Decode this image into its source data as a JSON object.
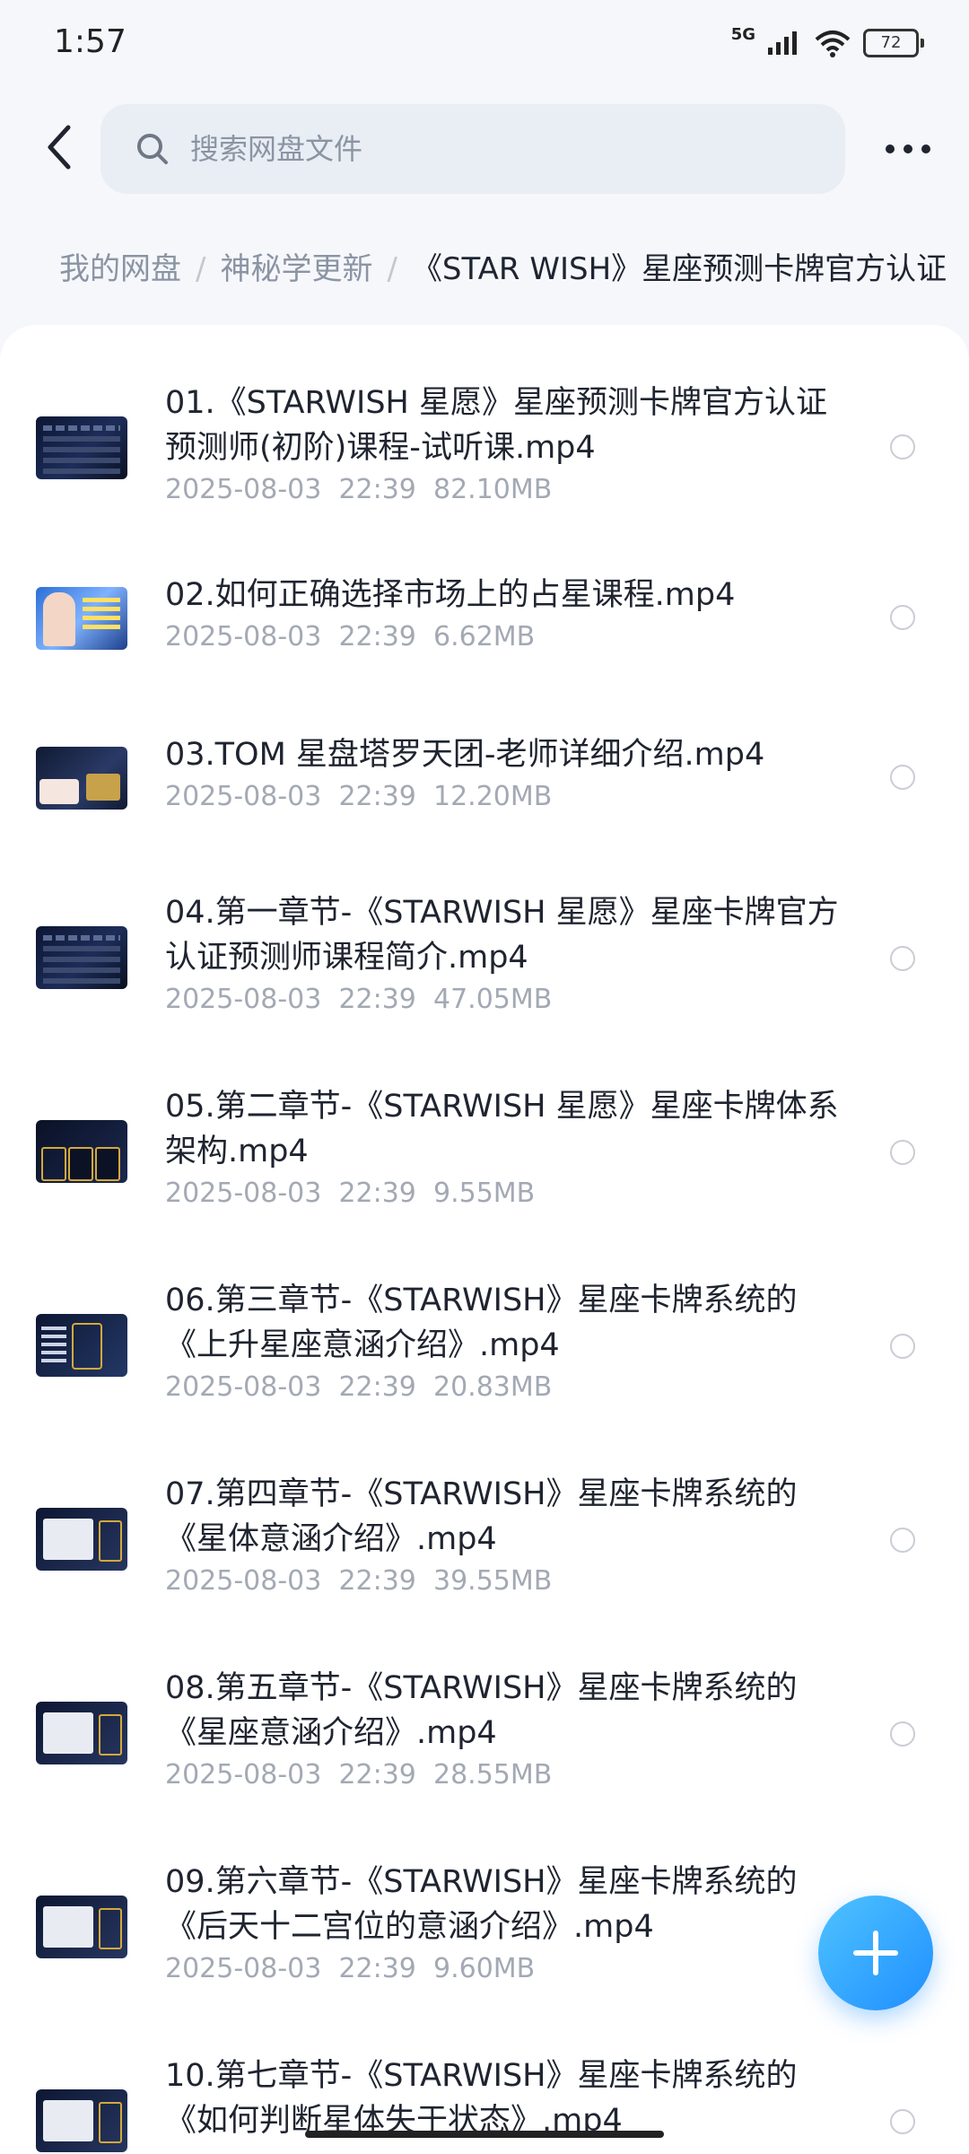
{
  "status_bar": {
    "time": "1:57",
    "network": "5G",
    "battery": "72"
  },
  "header": {
    "search_placeholder": "搜索网盘文件"
  },
  "breadcrumb": [
    "我的网盘",
    "神秘学更新",
    "《STAR WISH》星座预测卡牌官方认证"
  ],
  "files": [
    {
      "name": "01.《STARWISH 星愿》星座预测卡牌官方认证预测师(初阶)课程-试听课.mp4",
      "date": "2025-08-03",
      "time": "22:39",
      "size": "82.10MB",
      "thumb": "dark"
    },
    {
      "name": "02.如何正确选择市场上的占星课程.mp4",
      "date": "2025-08-03",
      "time": "22:39",
      "size": "6.62MB",
      "thumb": "person"
    },
    {
      "name": "03.TOM 星盘塔罗天团-老师详细介绍.mp4",
      "date": "2025-08-03",
      "time": "22:39",
      "size": "12.20MB",
      "thumb": "red"
    },
    {
      "name": "04.第一章节-《STARWISH 星愿》星座卡牌官方认证预测师课程简介.mp4",
      "date": "2025-08-03",
      "time": "22:39",
      "size": "47.05MB",
      "thumb": "dark"
    },
    {
      "name": "05.第二章节-《STARWISH 星愿》星座卡牌体系架构.mp4",
      "date": "2025-08-03",
      "time": "22:39",
      "size": "9.55MB",
      "thumb": "gold"
    },
    {
      "name": "06.第三章节-《STARWISH》星座卡牌系统的《上升星座意涵介绍》.mp4",
      "date": "2025-08-03",
      "time": "22:39",
      "size": "20.83MB",
      "thumb": "card"
    },
    {
      "name": "07.第四章节-《STARWISH》星座卡牌系统的《星体意涵介绍》.mp4",
      "date": "2025-08-03",
      "time": "22:39",
      "size": "39.55MB",
      "thumb": "list"
    },
    {
      "name": "08.第五章节-《STARWISH》星座卡牌系统的《星座意涵介绍》.mp4",
      "date": "2025-08-03",
      "time": "22:39",
      "size": "28.55MB",
      "thumb": "list"
    },
    {
      "name": "09.第六章节-《STARWISH》星座卡牌系统的《后天十二宫位的意涵介绍》.mp4",
      "date": "2025-08-03",
      "time": "22:39",
      "size": "9.60MB",
      "thumb": "list"
    },
    {
      "name": "10.第七章节-《STARWISH》星座卡牌系统的《如何判断星体失于状态》.mp4",
      "date": "",
      "time": "",
      "size": "",
      "thumb": "list"
    }
  ],
  "colors": {
    "accent": "#1f8fff",
    "text_primary": "#1f2430",
    "text_secondary": "#a3a9b4"
  },
  "icons": {
    "back": "chevron-left-icon",
    "search": "search-icon",
    "more": "more-dots-icon",
    "fab": "plus-icon"
  }
}
